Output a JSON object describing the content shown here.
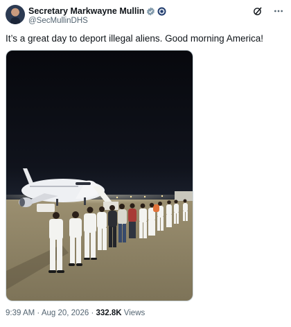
{
  "author": {
    "display_name": "Secretary Markwayne Mullin",
    "handle": "@SecMullinDHS"
  },
  "tweet": {
    "text": "It’s a great day to deport illegal aliens. Good morning America!"
  },
  "meta": {
    "time": "9:39 AM",
    "sep1": "·",
    "date": "Aug 20, 2026",
    "sep2": "·",
    "views_count": "332.8K",
    "views_label": "Views"
  },
  "icons": {
    "verified": "verified-badge-icon",
    "government": "government-seal-icon",
    "grok": "grok-icon",
    "more": "more-icon"
  },
  "colors": {
    "verified_blue": "#1d9bf0",
    "secondary_text": "#536471",
    "night_sky": "#0b0d14"
  }
}
